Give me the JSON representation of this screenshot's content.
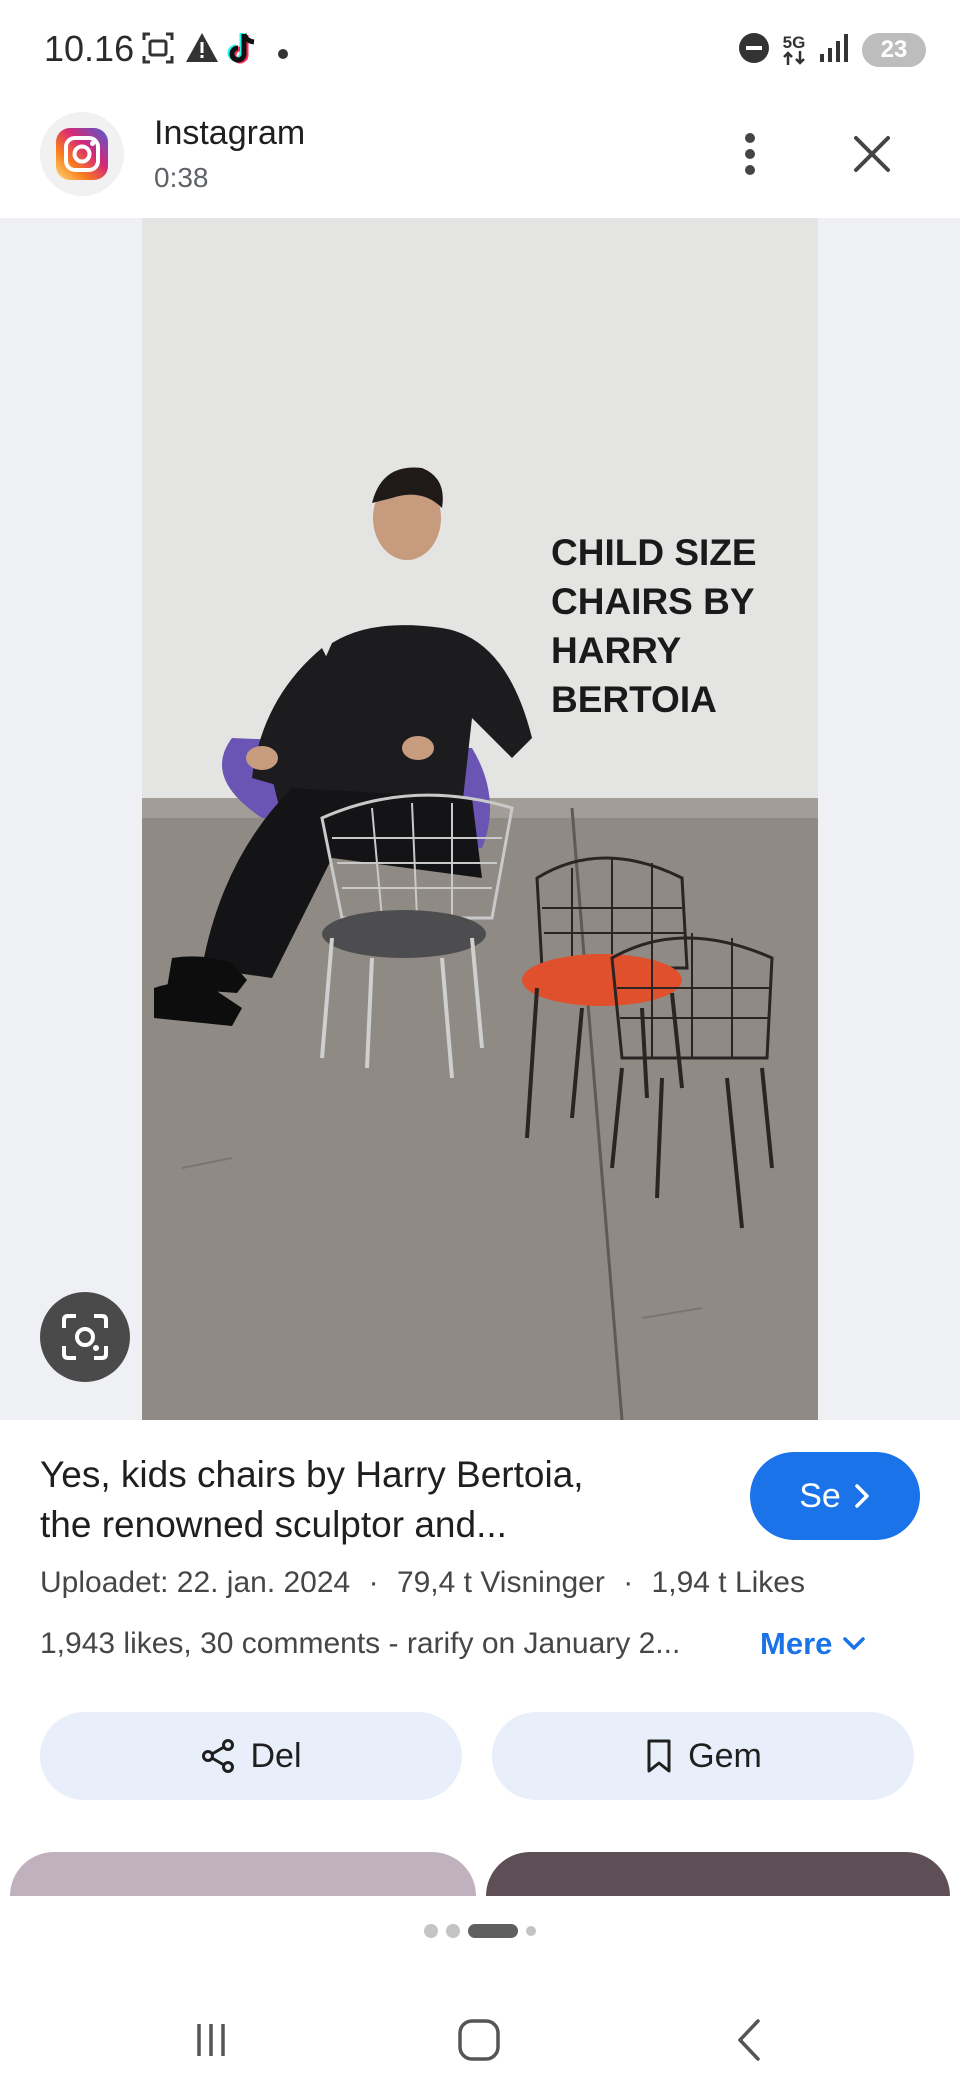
{
  "status_bar": {
    "time": "10.16",
    "network": "5G",
    "battery": "23"
  },
  "app": {
    "name": "Instagram",
    "duration": "0:38"
  },
  "image": {
    "overlay_text": [
      "CHILD SIZE",
      "CHAIRS BY",
      "HARRY",
      "BERTOIA"
    ]
  },
  "result": {
    "title_line1": "Yes, kids chairs by Harry Bertoia,",
    "title_line2": "the renowned sculptor and...",
    "see_button": "Se",
    "uploaded": "Uploadet: 22. jan. 2024",
    "separator": "·",
    "views": "79,4 t Visninger",
    "likes": "1,94 t Likes",
    "description": "1,943 likes, 30 comments - rarify on January 2...",
    "more_label": "Mere"
  },
  "actions": {
    "share_label": "Del",
    "save_label": "Gem"
  },
  "colors": {
    "accent": "#1a73e8",
    "action_bg": "#e8effa",
    "image_bg": "#eef0f4"
  }
}
